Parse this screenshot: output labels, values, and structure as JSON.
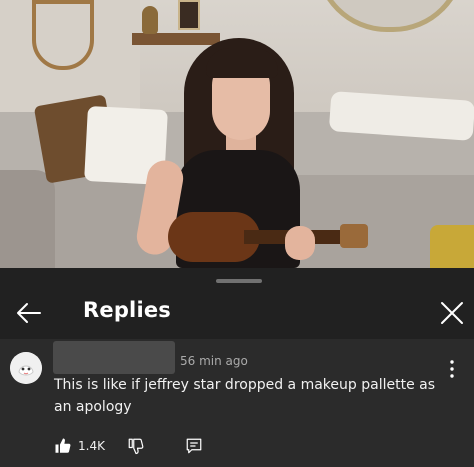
{
  "sheet": {
    "title": "Replies",
    "back_icon": "arrow-left-icon",
    "close_icon": "close-icon"
  },
  "comment": {
    "timestamp": "56 min ago",
    "text": "This is like if jeffrey star dropped a makeup pallette as an apology",
    "likes": "1.4K",
    "icons": [
      "thumb-up-icon",
      "thumb-down-icon",
      "reply-icon",
      "more-vert-icon"
    ]
  },
  "colors": {
    "sheet_bg": "#212121",
    "comment_bg": "#2b2b2b",
    "secondary_text": "#aaaaaa"
  }
}
